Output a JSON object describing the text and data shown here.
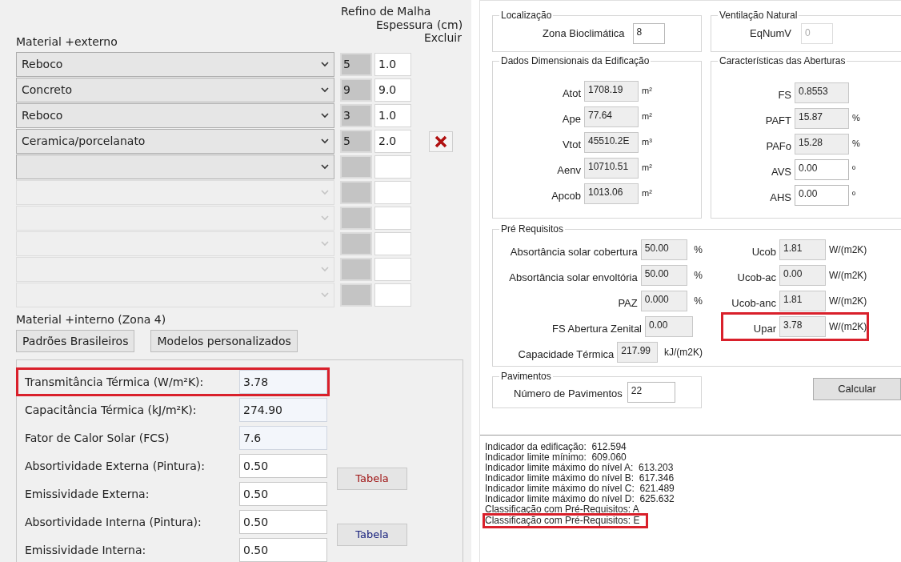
{
  "layers": {
    "header": {
      "material": "Material +externo",
      "refino": "Refino de Malha",
      "espessura": "Espessura (cm)",
      "excluir": "Excluir"
    },
    "rows": [
      {
        "material": "Reboco",
        "refino": "5",
        "espessura": "1.0",
        "enabled": true,
        "delete": false
      },
      {
        "material": "Concreto",
        "refino": "9",
        "espessura": "9.0",
        "enabled": true,
        "delete": false
      },
      {
        "material": "Reboco",
        "refino": "3",
        "espessura": "1.0",
        "enabled": true,
        "delete": false
      },
      {
        "material": "Ceramica/porcelanato",
        "refino": "5",
        "espessura": "2.0",
        "enabled": true,
        "delete": true
      },
      {
        "enabled": true,
        "delete": false
      },
      {
        "enabled": false,
        "delete": false
      },
      {
        "enabled": false,
        "delete": false
      },
      {
        "enabled": false,
        "delete": false
      },
      {
        "enabled": false,
        "delete": false
      },
      {
        "enabled": false,
        "delete": false
      }
    ]
  },
  "interno": {
    "label": "Material +interno (Zona 4)",
    "buttons": [
      "Padrões Brasileiros",
      "Modelos personalizados"
    ]
  },
  "properties": [
    {
      "label": "Transmitância Térmica (W/m²K):",
      "value": "3.78",
      "readonly": true,
      "highlighted": true
    },
    {
      "label": "Capacitância Térmica (kJ/m²K):",
      "value": "274.90",
      "readonly": true,
      "highlighted": false
    },
    {
      "label": "Fator de Calor Solar (FCS)",
      "value": "7.6",
      "readonly": true,
      "highlighted": false
    },
    {
      "label": "Absortividade Externa (Pintura):",
      "value": "0.50",
      "readonly": false,
      "highlighted": false
    },
    {
      "label": "Emissividade Externa:",
      "value": "0.50",
      "readonly": false,
      "highlighted": false
    },
    {
      "label": "Absortividade Interna (Pintura):",
      "value": "0.50",
      "readonly": false,
      "highlighted": false
    },
    {
      "label": "Emissividade Interna:",
      "value": "0.50",
      "readonly": false,
      "highlighted": false
    }
  ],
  "table_buttons": [
    {
      "label": "Tabela",
      "color": "#a01818"
    },
    {
      "label": "Tabela",
      "color": "#1a237e"
    }
  ],
  "localizacao": {
    "title": "Localização",
    "label": "Zona Bioclimática",
    "value": "8"
  },
  "ventilacao": {
    "title": "Ventilação Natural",
    "label": "EqNumV",
    "value": "0",
    "disabled": true
  },
  "dados": {
    "title": "Dados Dimensionais da Edificação",
    "rows": [
      {
        "label": "Atot",
        "value": "1708.19",
        "unit": "m²"
      },
      {
        "label": "Ape",
        "value": "77.64",
        "unit": "m²"
      },
      {
        "label": "Vtot",
        "value": "45510.2E",
        "unit": "m³"
      },
      {
        "label": "Aenv",
        "value": "10710.51",
        "unit": "m²"
      },
      {
        "label": "Apcob",
        "value": "1013.06",
        "unit": "m²"
      }
    ]
  },
  "aberturas": {
    "title": "Características das Aberturas",
    "rows": [
      {
        "label": "FS",
        "value": "0.8553",
        "readonly": true
      },
      {
        "label": "PAFT",
        "value": "15.87",
        "unit": "%",
        "readonly": true
      },
      {
        "label": "PAFo",
        "value": "15.28",
        "unit": "%",
        "readonly": true
      },
      {
        "label": "AVS",
        "value": "0.00",
        "unit": "º",
        "readonly": false
      },
      {
        "label": "AHS",
        "value": "0.00",
        "unit": "º",
        "readonly": false
      }
    ]
  },
  "pre_requisitos": {
    "title": "Pré Requisitos",
    "left": [
      {
        "label": "Absortância solar cobertura",
        "value": "50.00",
        "unit": "%"
      },
      {
        "label": "Absortância solar envoltória",
        "value": "50.00",
        "unit": "%"
      },
      {
        "label": "PAZ",
        "value": "0.000",
        "unit": "%"
      },
      {
        "label": "FS Abertura Zenital",
        "value": "0.00"
      },
      {
        "label": "Capacidade Térmica",
        "value": "217.99",
        "unit": "kJ/(m2K)"
      }
    ],
    "right": [
      {
        "label": "Ucob",
        "value": "1.81",
        "unit": "W/(m2K)",
        "highlighted": false
      },
      {
        "label": "Ucob-ac",
        "value": "0.00",
        "unit": "W/(m2K)",
        "highlighted": false
      },
      {
        "label": "Ucob-anc",
        "value": "1.81",
        "unit": "W/(m2K)",
        "highlighted": false
      },
      {
        "label": "Upar",
        "value": "3.78",
        "unit": "W/(m2K)",
        "highlighted": true
      }
    ]
  },
  "pavimentos": {
    "title": "Pavimentos",
    "label": "Número de Pavimentos",
    "value": "22"
  },
  "calcular": "Calcular",
  "results": [
    {
      "text": "Indicador da edificação:  612.594",
      "highlighted": false
    },
    {
      "text": "Indicador limite mínimo:  609.060",
      "highlighted": false
    },
    {
      "text": "Indicador limite máximo do nível A:  613.203",
      "highlighted": false
    },
    {
      "text": "Indicador limite máximo do nível B:  617.346",
      "highlighted": false
    },
    {
      "text": "Indicador limite máximo do nível C:  621.489",
      "highlighted": false
    },
    {
      "text": "Indicador limite máximo do nível D:  625.632",
      "highlighted": false
    },
    {
      "text": "Classificação com Pré-Requisitos: A",
      "highlighted": false
    },
    {
      "text": "Classificação com Pré-Requisitos: E",
      "highlighted": true
    }
  ]
}
